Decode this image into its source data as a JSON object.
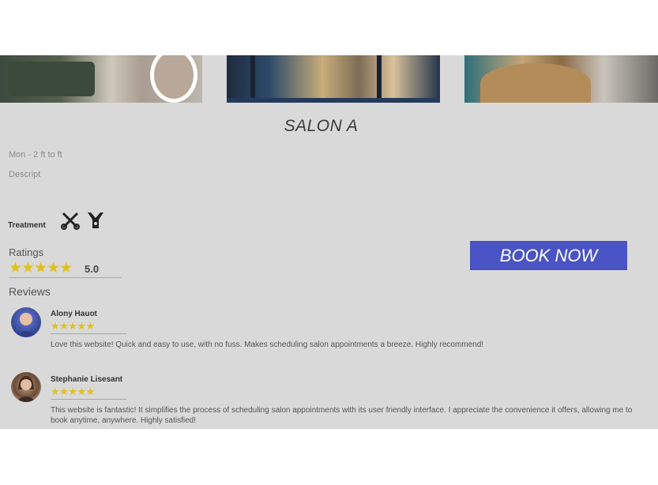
{
  "salon": {
    "name": "SALON A",
    "meta_line": "Mon - 2 ft to ft",
    "description": "Descript"
  },
  "gallery": [
    "salon-chairs-photo",
    "salon-storefront-photo",
    "salon-interior-photo"
  ],
  "treatment": {
    "label": "Treatment",
    "icons": [
      "scissors-comb-icon",
      "hair-clipper-icon"
    ]
  },
  "ratings": {
    "label": "Ratings",
    "stars": "★★★★★",
    "score": "5.0"
  },
  "actions": {
    "book_label": "BOOK NOW"
  },
  "reviews": {
    "label": "Reviews",
    "items": [
      {
        "name": "Alony Hauot",
        "stars": "★★★★★",
        "text": "Love this website! Quick and easy to use, with no fuss. Makes scheduling salon appointments a breeze. Highly recommend!"
      },
      {
        "name": "Stephanie Lisesant",
        "stars": "★★★★★",
        "text": "This website is fantastic! It simplifies the process of scheduling salon appointments with its user friendly interface. I appreciate the convenience it offers, allowing me to book anytime, anywhere. Highly satisfied!"
      }
    ]
  },
  "colors": {
    "panel_bg": "#d9d9d9",
    "accent_button": "#4a54c4",
    "star": "#e0c11a"
  }
}
